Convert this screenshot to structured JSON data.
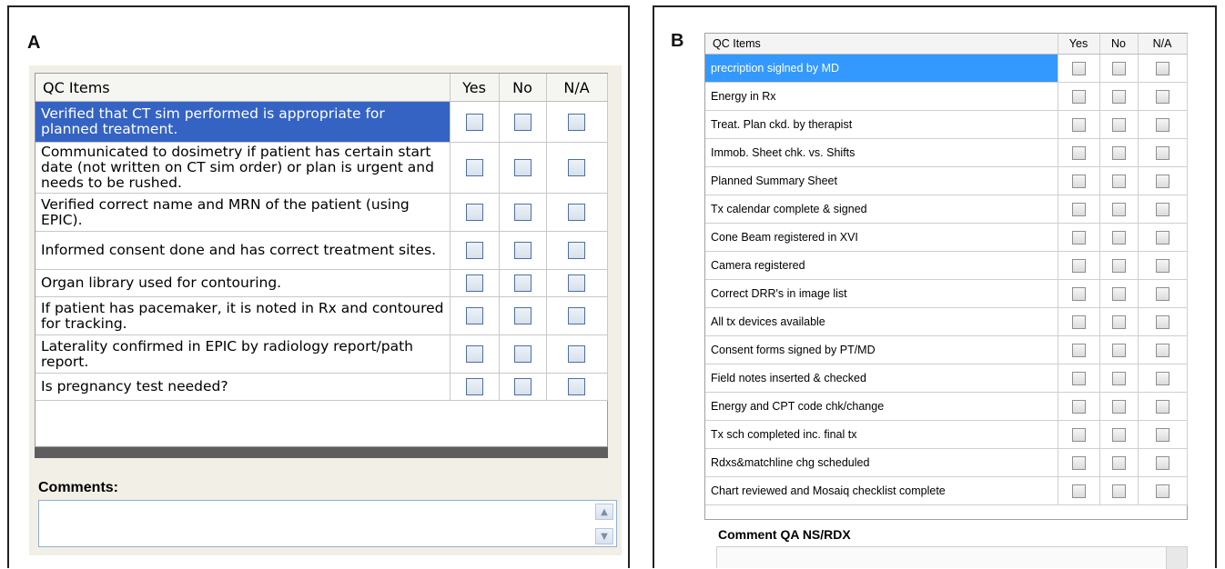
{
  "panel_a": {
    "letter": "A",
    "headers": {
      "item": "QC Items",
      "yes": "Yes",
      "no": "No",
      "na": "N/A"
    },
    "rows": [
      {
        "text": "Verified that CT sim performed is appropriate for planned treatment.",
        "selected": true
      },
      {
        "text": "Communicated to dosimetry if patient has certain start date (not written on CT sim order) or plan is urgent and needs to be rushed.",
        "selected": false
      },
      {
        "text": "Verified correct name and MRN of the patient (using EPIC).",
        "selected": false
      },
      {
        "text": "Informed consent done and has correct treatment sites.",
        "selected": false
      },
      {
        "text": "Organ library used for contouring.",
        "selected": false
      },
      {
        "text": "If patient has pacemaker, it is noted in Rx and contoured for tracking.",
        "selected": false
      },
      {
        "text": "Laterality confirmed in EPIC by radiology report/path report.",
        "selected": false
      },
      {
        "text": "Is pregnancy test needed?",
        "selected": false
      }
    ],
    "comments_label": "Comments:",
    "comments_value": ""
  },
  "panel_b": {
    "letter": "B",
    "headers": {
      "item": "QC Items",
      "yes": "Yes",
      "no": "No",
      "na": "N/A"
    },
    "rows": [
      {
        "text": "precription siglned by MD",
        "selected": true
      },
      {
        "text": "Energy in Rx",
        "selected": false
      },
      {
        "text": "Treat. Plan ckd. by therapist",
        "selected": false
      },
      {
        "text": "Immob. Sheet chk. vs. Shifts",
        "selected": false
      },
      {
        "text": "Planned Summary Sheet",
        "selected": false
      },
      {
        "text": "Tx calendar complete & signed",
        "selected": false
      },
      {
        "text": "Cone Beam registered in XVI",
        "selected": false
      },
      {
        "text": "Camera registered",
        "selected": false
      },
      {
        "text": "Correct DRR's in image list",
        "selected": false
      },
      {
        "text": "All tx devices available",
        "selected": false
      },
      {
        "text": "Consent forms signed by PT/MD",
        "selected": false
      },
      {
        "text": "Field notes inserted & checked",
        "selected": false
      },
      {
        "text": "Energy and CPT code chk/change",
        "selected": false
      },
      {
        "text": "Tx sch completed inc. final tx",
        "selected": false
      },
      {
        "text": "Rdxs&matchline chg scheduled",
        "selected": false
      },
      {
        "text": "Chart reviewed and Mosaiq checklist complete",
        "selected": false
      }
    ],
    "comments_label": "Comment QA NS/RDX",
    "comments_value": ""
  },
  "colors": {
    "selection_a": "#3463c4",
    "selection_b": "#3399ff",
    "grid_footer": "#5e5e5e"
  }
}
